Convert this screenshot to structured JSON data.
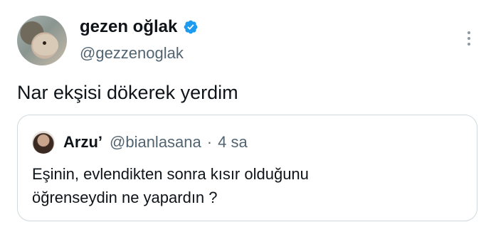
{
  "author": {
    "display_name": "gezen oğlak",
    "handle": "@gezzenoglak",
    "avatar_icon": "goat-avatar",
    "verified_icon": "verified-badge-icon",
    "verified_color": "#1d9bf0"
  },
  "tweet": {
    "text": "Nar ekşisi dökerek yerdim"
  },
  "more_icon": "more-vertical-icon",
  "quote": {
    "display_name": "Arzu’",
    "handle": "@bianlasana",
    "separator": "·",
    "time": "4 sa",
    "text_line_1": "Eşinin, evlendikten sonra kısır olduğunu",
    "text_line_2": "öğrenseydin ne yapardın ?"
  }
}
